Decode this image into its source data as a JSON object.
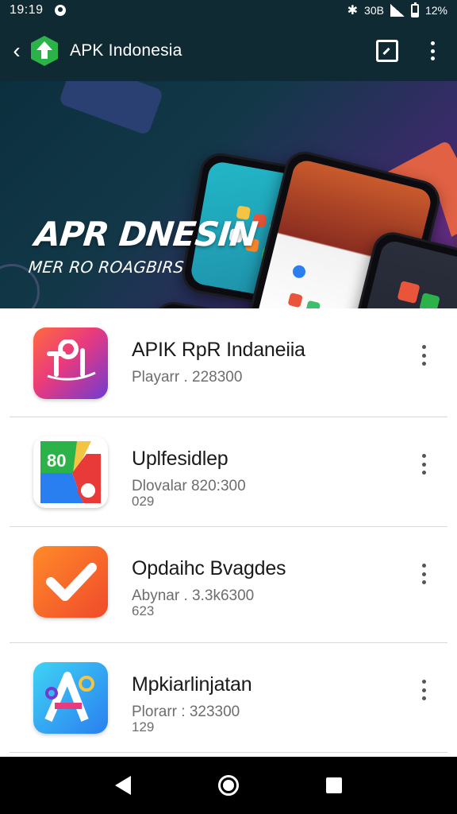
{
  "status_bar": {
    "time": "19:19",
    "network": "30B",
    "battery": "12%"
  },
  "app_bar": {
    "title": "APK Indonesia",
    "icons": [
      "back-icon",
      "app-logo-icon",
      "open-in-icon",
      "more-vert-icon"
    ]
  },
  "banner": {
    "title": "APR DNESIN",
    "subtitle": "MER RO ROAGBIRS"
  },
  "items": [
    {
      "name": "APIK RpR Indaneiia",
      "meta": "Playarr . 228300",
      "meta2": ""
    },
    {
      "name": "Uplfesidlep",
      "meta": "Dlovalar  820:300",
      "meta2": "029"
    },
    {
      "name": "Opdaihc Bvagdes",
      "meta": "Abynar . 3.3k6300",
      "meta2": "623"
    },
    {
      "name": "Mpkiarlinjatan",
      "meta": "Plorarr : 323300",
      "meta2": "129"
    }
  ],
  "colors": {
    "app_bar": "#0f2a33",
    "logo_green": "#2bb34a",
    "nav_bar": "#000000"
  }
}
